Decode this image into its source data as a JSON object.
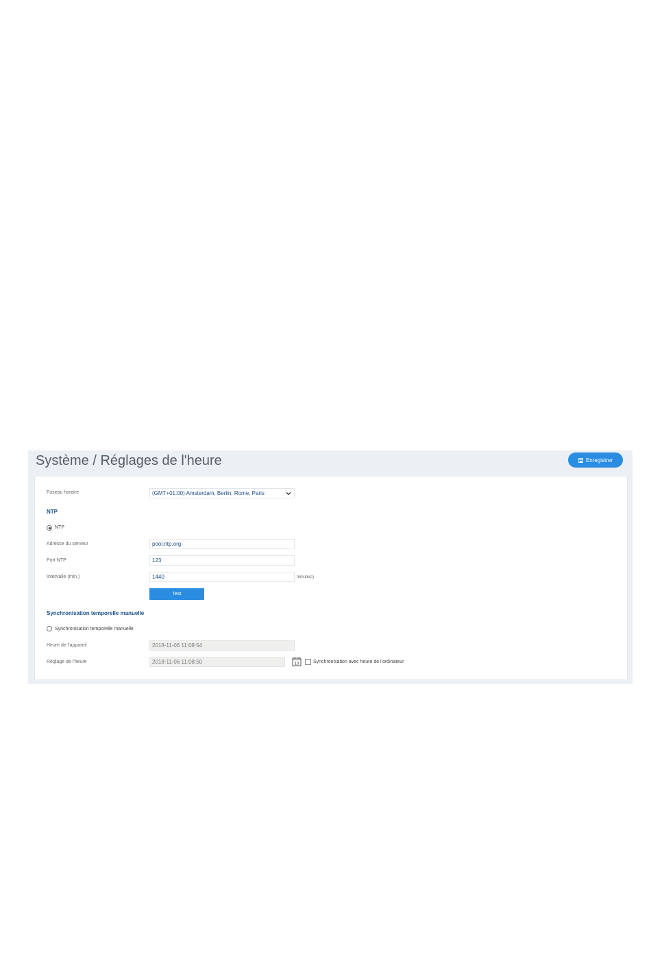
{
  "header": {
    "title": "Système / Réglages de l'heure",
    "save_label": "Enregistrer"
  },
  "timezone": {
    "label": "Fuseau horaire",
    "value": "(GMT+01:00) Amsterdam, Berlin, Rome, Paris"
  },
  "ntp": {
    "section_title": "NTP",
    "radio_label": "NTP",
    "radio_selected": true,
    "server_label": "Adresse du serveur",
    "server_value": "pool.ntp.org",
    "port_label": "Port NTP",
    "port_value": "123",
    "interval_label": "Intervalle (min.)",
    "interval_value": "1440",
    "interval_unit": "minute(s)",
    "test_label": "Test"
  },
  "manual": {
    "section_title": "Synchronisation temporelle manuelle",
    "radio_label": "Synchronisation temporelle manuelle",
    "radio_selected": false,
    "device_time_label": "Heure de l'appareil",
    "device_time_value": "2018-11-06 11:08:54",
    "set_time_label": "Réglage de l'heure",
    "set_time_value": "2018-11-06 11:08:50",
    "calendar_day": "10",
    "sync_pc_label": "Synchronisation avec heure de l'ordinateur",
    "sync_pc_checked": false
  },
  "colors": {
    "accent": "#2a8de2",
    "section_title": "#1a4f8a",
    "panel_bg": "#eceff3"
  }
}
